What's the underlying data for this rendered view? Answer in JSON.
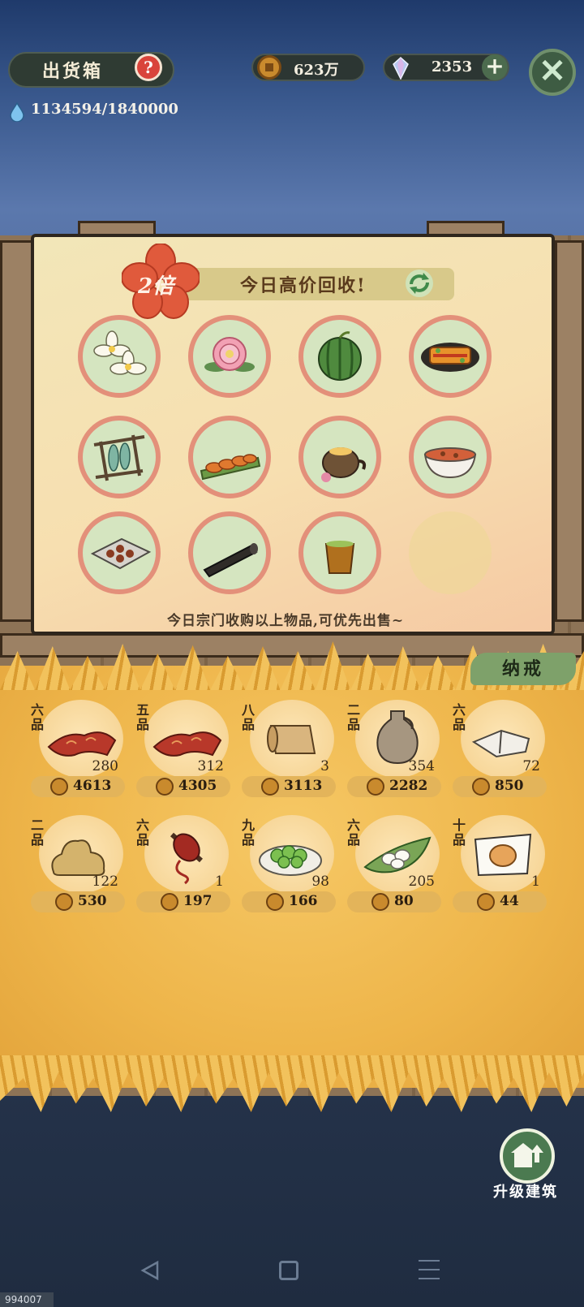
{
  "header": {
    "title": "出货箱",
    "help_icon": "question-mark-icon",
    "water_value": "1134594/1840000",
    "coins": "623万",
    "gems": "2353",
    "add_label": "+",
    "close_label": "✕"
  },
  "poster": {
    "multiplier": "2倍",
    "banner_text": "今日高价回收!",
    "footer_text": "今日宗门收购以上物品,可优先出售~",
    "items": [
      {
        "icon": "white-flower-icon"
      },
      {
        "icon": "pink-peony-icon"
      },
      {
        "icon": "watermelon-icon"
      },
      {
        "icon": "grilled-dish-icon"
      },
      {
        "icon": "dried-fish-rack-icon"
      },
      {
        "icon": "fried-shrimp-icon"
      },
      {
        "icon": "teapot-icon"
      },
      {
        "icon": "soup-bowl-icon"
      },
      {
        "icon": "pastry-tray-icon"
      },
      {
        "icon": "ink-stick-icon"
      },
      {
        "icon": "tea-cup-icon"
      }
    ]
  },
  "inventory": {
    "tab_label": "纳戒",
    "items": [
      {
        "grade": "六品",
        "icon": "red-fabric-icon",
        "qty": "280",
        "price": "4613"
      },
      {
        "grade": "五品",
        "icon": "red-fabric-icon",
        "qty": "312",
        "price": "4305"
      },
      {
        "grade": "八品",
        "icon": "scroll-icon",
        "qty": "3",
        "price": "3113"
      },
      {
        "grade": "二品",
        "icon": "vase-icon",
        "qty": "354",
        "price": "2282"
      },
      {
        "grade": "六品",
        "icon": "cloth-bundle-icon",
        "qty": "72",
        "price": "850"
      },
      {
        "grade": "二品",
        "icon": "ore-icon",
        "qty": "122",
        "price": "530"
      },
      {
        "grade": "六品",
        "icon": "thread-spool-icon",
        "qty": "1",
        "price": "197"
      },
      {
        "grade": "九品",
        "icon": "vegetable-plate-icon",
        "qty": "98",
        "price": "166"
      },
      {
        "grade": "六品",
        "icon": "eggs-on-leaf-icon",
        "qty": "205",
        "price": "80"
      },
      {
        "grade": "十品",
        "icon": "bun-on-paper-icon",
        "qty": "1",
        "price": "44"
      }
    ]
  },
  "upgrade": {
    "label": "升级建筑",
    "icon": "upgrade-building-icon"
  },
  "nav": {
    "back": "back-icon",
    "home": "home-icon",
    "menu": "menu-icon"
  },
  "build_id": "994007",
  "colors": {
    "poster_ring": "#e3907a",
    "item_bg": "#d5e5c0",
    "straw": "#eeb54a",
    "price_pill": "#e3b45a"
  }
}
